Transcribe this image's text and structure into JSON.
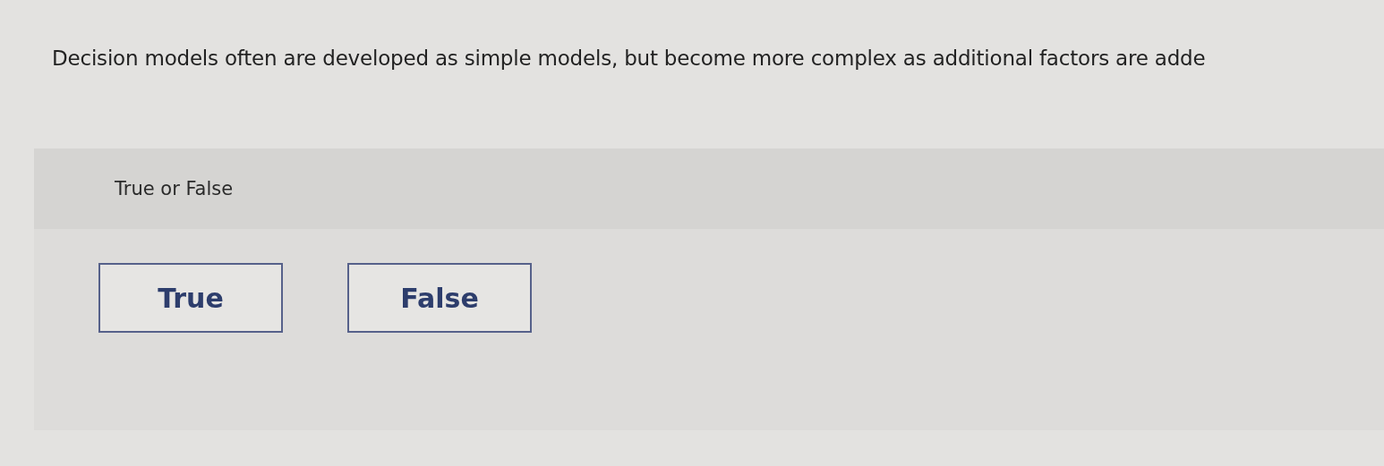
{
  "question": {
    "text": "Decision models often are developed as simple models, but become more complex as additional factors are adde"
  },
  "prompt": {
    "text": "True or False"
  },
  "options": [
    {
      "label": "True",
      "selected": false
    },
    {
      "label": "False",
      "selected": false
    }
  ]
}
